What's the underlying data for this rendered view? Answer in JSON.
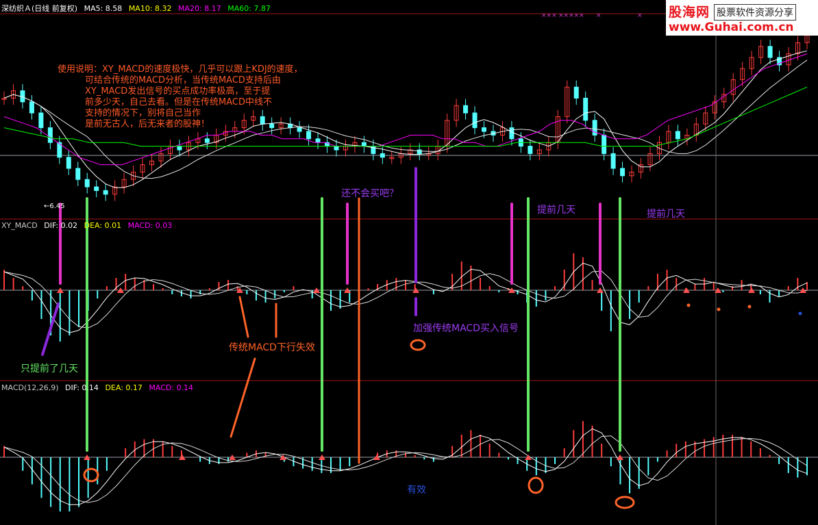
{
  "header": {
    "title": "深纺织Ａ(日线 前复权)",
    "ma5": "MA5: 8.58",
    "ma10": "MA10: 8.32",
    "ma20": "MA20: 8.17",
    "ma60": "MA60: 7.87"
  },
  "xy_header": {
    "name": "XY_MACD",
    "dif": "DIF: 0.02",
    "dea": "DEA: 0.01",
    "macd": "MACD: 0.03"
  },
  "macd_header": {
    "name": "MACD(12,26,9)",
    "dif": "DIF: 0.14",
    "dea": "DEA: 0.17",
    "macd": "MACD: 0.14"
  },
  "low_price_tag": "←6.45",
  "note_lines": [
    "使用说明：XY_MACD的速度极快，几乎可以跟上KDJ的速度，",
    "可结合传统的MACD分析，当传统MACD支持后由",
    "XY_MACD发出信号的买点成功率极高，至于提",
    "前多少天，自己去看。但是在传统MACD中线不",
    "支持的情况下，别将自己当作",
    "是前无古人，后无来者的股神！"
  ],
  "annotations": {
    "wont_buy": "还不会买吧？",
    "early_1": "提前几天",
    "early_2": "提前几天",
    "only_early": "只提前了几天",
    "traditional_fail": "传统MACD下行失效",
    "enhanced": "加强传统MACD买入信号",
    "effective": "有效"
  },
  "logo": {
    "name": "股海网",
    "tagline": "股票软件资源分享",
    "url": "www.Guhai.com.cn"
  },
  "colors": {
    "up": "#ff3c3c",
    "down": "#54ffff",
    "ma5": "#ffffff",
    "ma10": "#ffff00",
    "ma20": "#ff00ff",
    "ma60": "#00ff00",
    "note": "#ff5a28",
    "green_line": "#64e664",
    "magenta_line": "#e632c8",
    "orange_line": "#ff6428",
    "purple": "#8c28dc",
    "separator": "#a01414"
  },
  "chart_data": {
    "type": "line",
    "price_series": [
      9.1,
      9.3,
      9.0,
      8.7,
      8.3,
      7.9,
      7.5,
      7.2,
      6.9,
      6.7,
      6.6,
      6.5,
      6.7,
      6.9,
      7.1,
      7.3,
      7.4,
      7.6,
      7.8,
      7.7,
      7.9,
      8.0,
      7.9,
      8.1,
      8.2,
      8.3,
      8.5,
      8.6,
      8.4,
      8.3,
      8.4,
      8.3,
      8.2,
      8.0,
      7.9,
      7.8,
      7.7,
      7.8,
      7.9,
      7.8,
      7.6,
      7.5,
      7.5,
      7.6,
      7.7,
      7.6,
      7.6,
      7.8,
      8.5,
      8.9,
      8.7,
      8.3,
      8.2,
      8.1,
      8.3,
      8.0,
      7.8,
      7.6,
      7.7,
      7.9,
      8.6,
      9.4,
      9.1,
      8.5,
      8.1,
      7.6,
      7.2,
      7.0,
      7.1,
      7.3,
      7.6,
      7.9,
      8.2,
      8.0,
      8.1,
      8.4,
      8.7,
      9.0,
      9.2,
      9.6,
      9.9,
      10.2,
      10.5,
      10.2,
      10.0,
      10.3,
      10.6,
      10.8
    ],
    "ma20_series": [
      8.6,
      8.5,
      8.4,
      8.3,
      8.1,
      7.9,
      7.7,
      7.5,
      7.4,
      7.3,
      7.3,
      7.3,
      7.4,
      7.5,
      7.6,
      7.7,
      7.8,
      7.9,
      8.0,
      8.1,
      8.1,
      8.2,
      8.2,
      8.2,
      8.1,
      8.1,
      8.0,
      8.0,
      8.0,
      7.9,
      7.9,
      7.8,
      7.8,
      7.8,
      7.8,
      7.8,
      7.9,
      8.0,
      8.1,
      8.1,
      8.1,
      8.0,
      8.0,
      7.9,
      7.9,
      7.8,
      7.8,
      7.9,
      8.0,
      8.1,
      8.2,
      8.4,
      8.5,
      8.5,
      8.4,
      8.2,
      8.1,
      8.0,
      8.0,
      8.0,
      8.1,
      8.3,
      8.5,
      8.6,
      8.7,
      8.8,
      8.9,
      9.1,
      9.3,
      9.5,
      9.7,
      9.9,
      10.0,
      10.1,
      10.2,
      10.3
    ],
    "ma60_series": [
      8.3,
      8.2,
      8.1,
      8.0,
      8.0,
      7.9,
      7.9,
      7.9,
      7.8,
      7.8,
      7.8,
      7.8,
      7.8,
      7.8,
      7.8,
      7.8,
      7.8,
      7.8,
      7.8,
      7.8,
      7.8,
      7.8,
      7.8,
      7.8,
      7.8,
      7.8,
      7.8,
      7.8,
      7.8,
      7.8,
      7.9,
      7.9,
      7.9,
      7.9,
      7.9,
      7.8,
      7.8,
      7.8,
      7.8,
      7.9,
      8.0,
      8.2,
      8.4,
      8.6,
      8.8,
      9.0,
      9.2,
      9.4
    ],
    "xy_macd_histogram": [
      0.1,
      0.06,
      0.02,
      -0.05,
      -0.14,
      -0.22,
      -0.25,
      -0.22,
      -0.18,
      -0.1,
      -0.04,
      0.02,
      0.06,
      0.08,
      0.06,
      0.05,
      0.03,
      0.01,
      -0.02,
      -0.03,
      -0.04,
      -0.02,
      0.01,
      0.04,
      0.05,
      0.02,
      -0.02,
      -0.05,
      -0.06,
      -0.04,
      -0.01,
      0.02,
      0.0,
      -0.04,
      -0.08,
      -0.1,
      -0.09,
      -0.06,
      -0.02,
      0.01,
      0.03,
      0.05,
      0.06,
      0.05,
      0.03,
      0.0,
      -0.02,
      0.0,
      0.08,
      0.14,
      0.12,
      0.06,
      0.02,
      -0.01,
      0.01,
      -0.02,
      -0.06,
      -0.08,
      -0.05,
      0.02,
      0.1,
      0.18,
      0.16,
      0.05,
      -0.1,
      -0.2,
      -0.22,
      -0.14,
      -0.06,
      0.02,
      0.08,
      0.1,
      0.06,
      0.01,
      0.03,
      0.06,
      0.04,
      -0.01,
      0.02,
      0.05,
      0.03,
      -0.02,
      -0.06,
      -0.03,
      0.02,
      0.06,
      0.04
    ],
    "macd_histogram": [
      0.05,
      0.0,
      -0.06,
      -0.12,
      -0.18,
      -0.22,
      -0.24,
      -0.24,
      -0.22,
      -0.18,
      -0.12,
      -0.06,
      0.0,
      0.04,
      0.07,
      0.08,
      0.08,
      0.07,
      0.05,
      0.03,
      0.0,
      -0.02,
      -0.03,
      -0.03,
      -0.02,
      0.0,
      0.02,
      0.03,
      0.02,
      0.0,
      -0.02,
      -0.04,
      -0.05,
      -0.06,
      -0.07,
      -0.07,
      -0.06,
      -0.04,
      -0.02,
      0.0,
      0.02,
      0.03,
      0.03,
      0.02,
      0.01,
      -0.01,
      -0.02,
      0.0,
      0.05,
      0.1,
      0.12,
      0.1,
      0.06,
      0.02,
      -0.01,
      -0.03,
      -0.06,
      -0.08,
      -0.07,
      -0.03,
      0.04,
      0.12,
      0.16,
      0.14,
      0.06,
      -0.04,
      -0.12,
      -0.16,
      -0.14,
      -0.08,
      -0.02,
      0.03,
      0.06,
      0.07,
      0.07,
      0.08,
      0.09,
      0.1,
      0.1,
      0.09,
      0.07,
      0.04,
      0.01,
      -0.03,
      -0.07,
      -0.09,
      -0.08
    ]
  }
}
